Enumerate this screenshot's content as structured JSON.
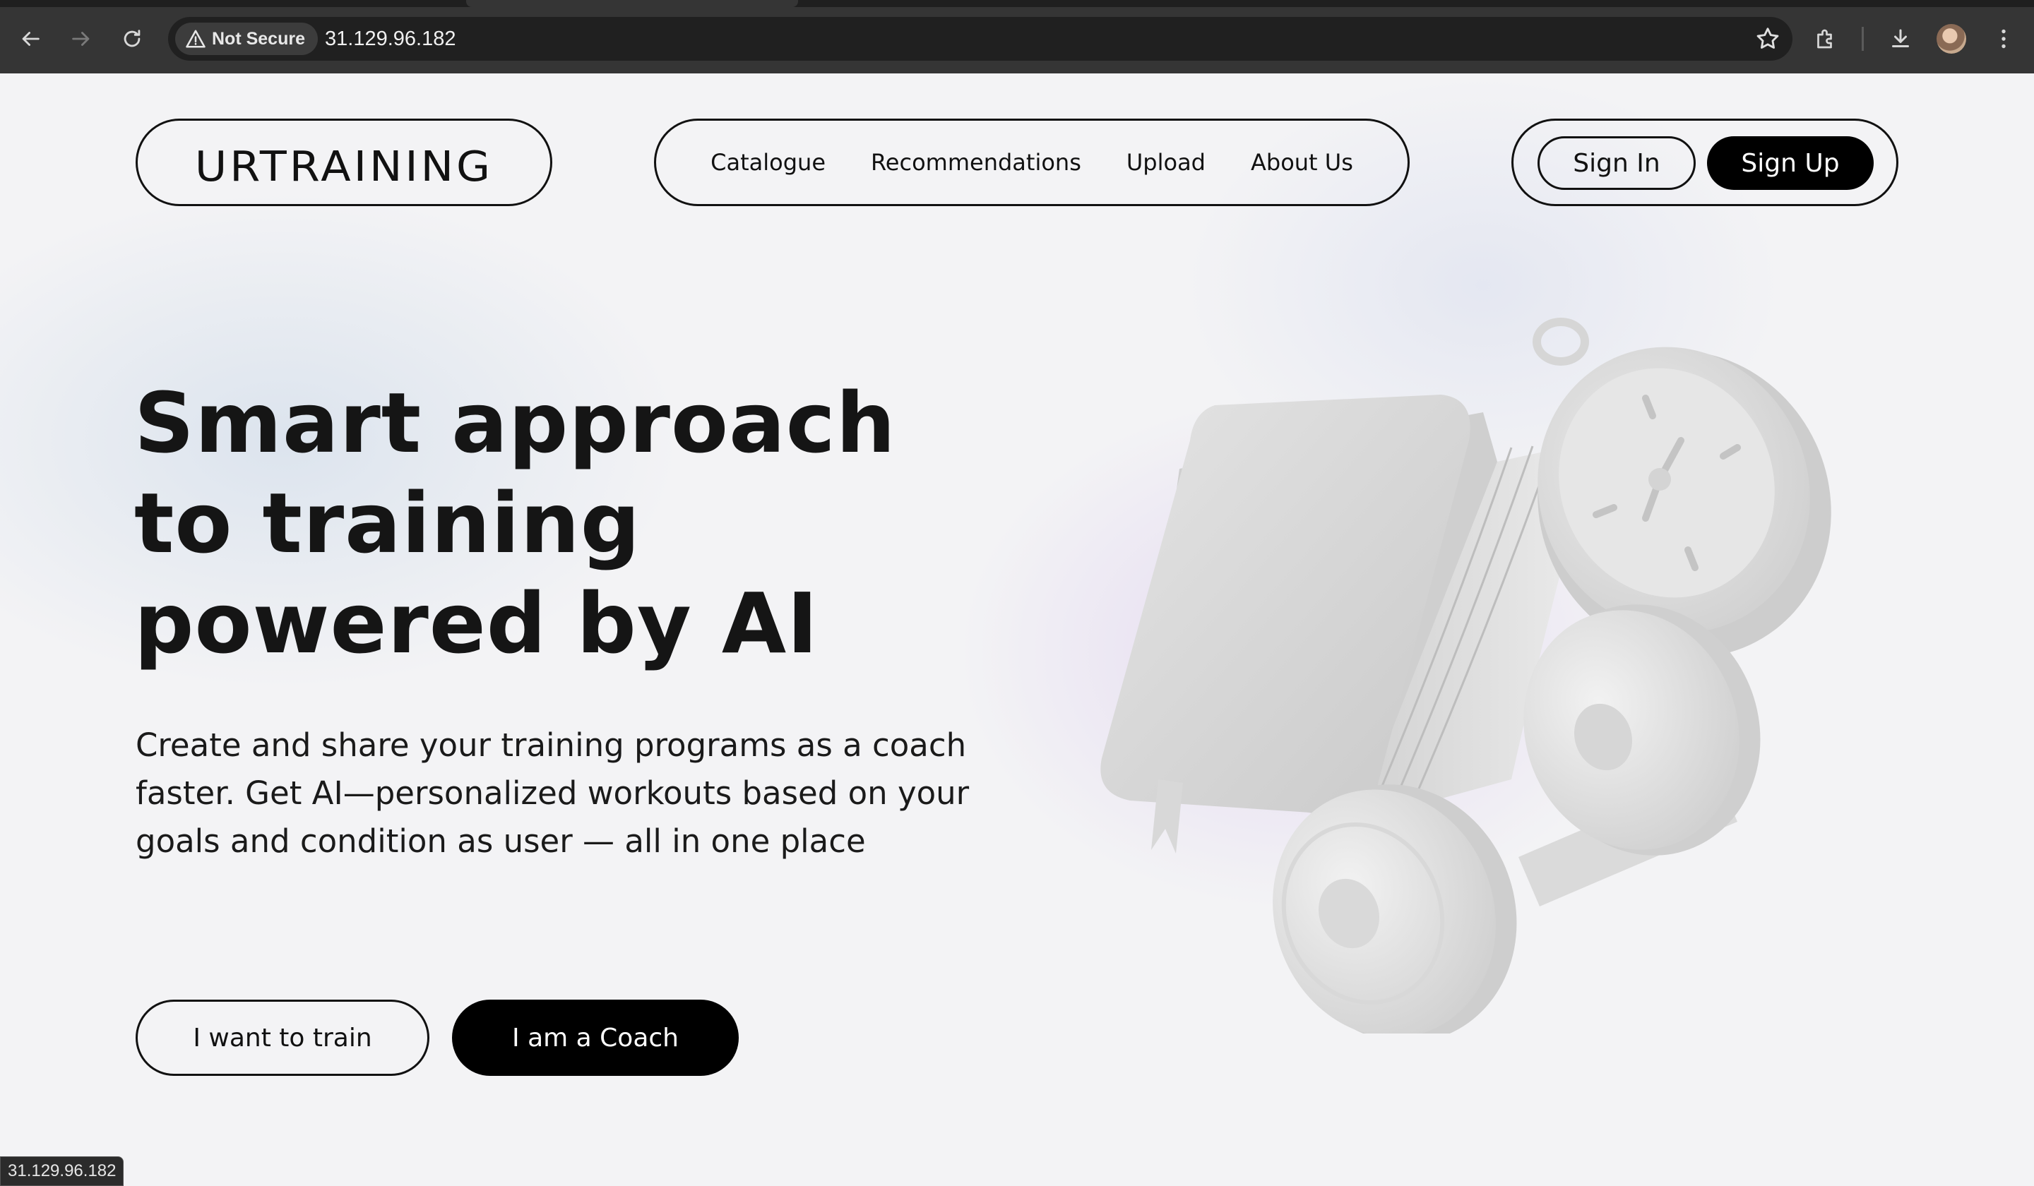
{
  "browser": {
    "security_label": "Not Secure",
    "url": "31.129.96.182",
    "icons": [
      "back-icon",
      "forward-icon",
      "reload-icon",
      "warning-icon",
      "star-icon",
      "extensions-icon",
      "download-icon",
      "avatar",
      "menu-icon"
    ]
  },
  "header": {
    "logo": "URTRAINING",
    "nav": [
      "Catalogue",
      "Recommendations",
      "Upload",
      "About Us"
    ],
    "sign_in": "Sign In",
    "sign_up": "Sign Up"
  },
  "hero": {
    "title_lines": [
      "Smart approach",
      "to training",
      "powered by AI"
    ],
    "subtitle": "Create and share your training programs as a coach faster. Get AI—personalized workouts based on your goals and condition as user — all in one place",
    "cta_train": "I want to train",
    "cta_coach": "I am a Coach"
  },
  "status_bar": {
    "text": "31.129.96.182"
  },
  "colors": {
    "accent": "#000000",
    "page_bg": "#f3f3f5",
    "chrome_bg": "#353535"
  }
}
